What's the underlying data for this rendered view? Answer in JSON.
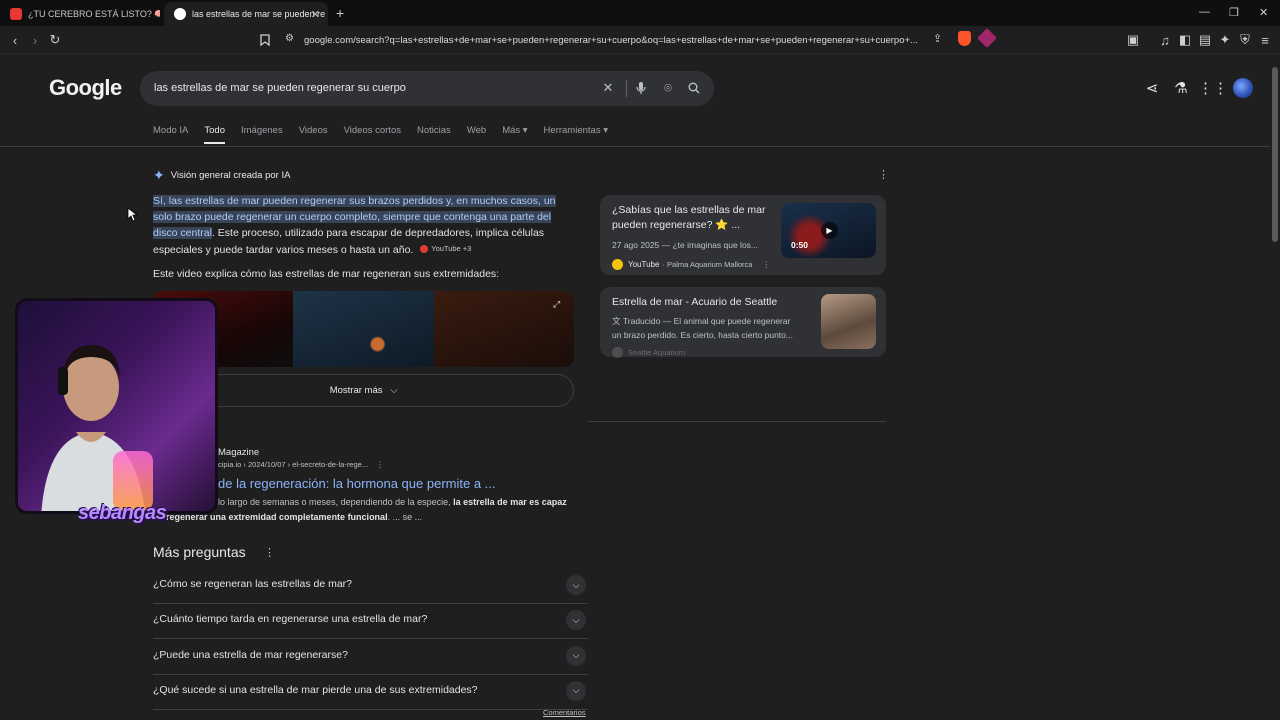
{
  "browser": {
    "tabs": [
      {
        "title": "¿TU CEREBRO ESTÁ LISTO? 🧠 100 P",
        "active": false,
        "favicon_color": "#e53935"
      },
      {
        "title": "las estrellas de mar se pueden re",
        "active": true,
        "favicon_color": "#ffffff"
      }
    ],
    "new_tab_label": "+",
    "url": "google.com/search?q=las+estrellas+de+mar+se+pueden+regenerar+su+cuerpo&oq=las+estrellas+de+mar+se+pueden+regenerar+su+cuerpo+...",
    "shield_badge": "",
    "alert_badge": "1"
  },
  "google": {
    "logo": "Google",
    "query": "las estrellas de mar se pueden regenerar su cuerpo",
    "nav_tabs": [
      "Modo IA",
      "Todo",
      "Imágenes",
      "Videos",
      "Videos cortos",
      "Noticias",
      "Web",
      "Más ▾",
      "Herramientas ▾"
    ],
    "active_tab": "Todo"
  },
  "ai_overview": {
    "heading": "Visión general creada por IA",
    "highlight": "Sí, las estrellas de mar pueden regenerar sus brazos perdidos y, en muchos casos, un solo brazo puede regenerar un cuerpo completo, siempre que contenga una parte del disco central",
    "rest": ". Este proceso, utilizado para escapar de depredadores, implica células especiales y puede tardar varios meses o hasta un año.",
    "source_chip": "YouTube +3",
    "video_label": "Este video explica cómo las estrellas de mar regeneran sus extremidades:",
    "show_more": "Mostrar más"
  },
  "side_cards": [
    {
      "title": "¿Sabías que las estrellas de mar pueden regenerarse? ⭐ ...",
      "meta": "27 ago 2025 — ¿te imaginas que los...",
      "source": "YouTube",
      "source_sub": "· Palma Aquarium Mallorca",
      "duration": "0:50"
    },
    {
      "title": "Estrella de mar - Acuario de Seattle",
      "meta1": "Traducido — El animal que puede regenerar",
      "meta2": "un brazo perdido. Es cierto, hasta cierto punto...",
      "source": "Seattle Aquarium"
    }
  ],
  "result": {
    "site": "Magazine",
    "url": "cipia.io › 2024/10/07 › el-secreto-de-la-rege...",
    "title": "de la regeneración: la hormona que permite a ...",
    "snippet_pre": "lo largo de semanas o meses, dependiendo de la especie, ",
    "snippet_bold1": "la estrella de mar es capaz",
    "snippet_bold2": "regenerar una extremidad completamente funcional",
    "snippet_post": ". ... se ..."
  },
  "paa": {
    "title": "Más preguntas",
    "questions": [
      "¿Cómo se regeneran las estrellas de mar?",
      "¿Cuánto tiempo tarda en regenerarse una estrella de mar?",
      "¿Puede una estrella de mar regenerarse?",
      "¿Qué sucede si una estrella de mar pierde una de sus extremidades?"
    ],
    "comments": "Comentarios"
  },
  "overlay": {
    "streamer_name": "sebangas"
  }
}
